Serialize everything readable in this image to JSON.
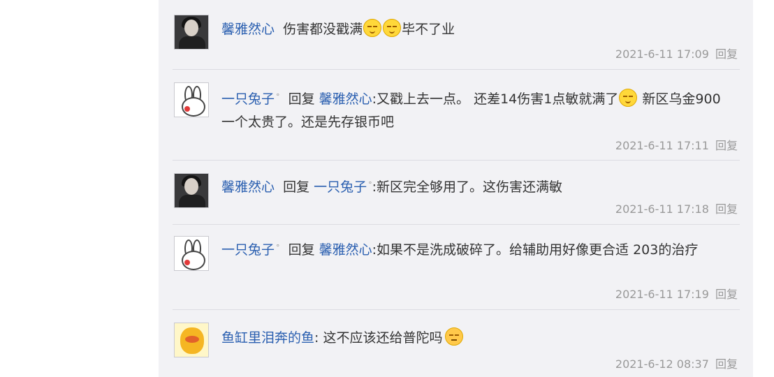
{
  "comments": [
    {
      "author": "馨雅然心",
      "reply_word": "",
      "reply_to": "",
      "text_before": "伤害都没戳满",
      "text_after": "毕不了业",
      "time": "2021-6-11 17:09",
      "reply_label": "回复"
    },
    {
      "author": "一只兔子",
      "author_suffix": "°",
      "reply_word": "回复",
      "reply_to": "馨雅然心",
      "text_before": ":又戳上去一点。 还差14伤害1点敏就满了",
      "text_after": " 新区乌金900一个太贵了。还是先存银币吧",
      "time": "2021-6-11 17:11",
      "reply_label": "回复"
    },
    {
      "author": "馨雅然心",
      "reply_word": "回复",
      "reply_to": "一只兔子",
      "reply_to_suffix": "°",
      "text": ":新区完全够用了。这伤害还满敏",
      "time": "2021-6-11 17:18",
      "reply_label": "回复"
    },
    {
      "author": "一只兔子",
      "author_suffix": "°",
      "reply_word": "回复",
      "reply_to": "馨雅然心",
      "text": ":如果不是洗成破碎了。给辅助用好像更合适 203的治疗",
      "time": "2021-6-11 17:19",
      "reply_label": "回复"
    },
    {
      "author": "鱼缸里泪奔的鱼",
      "text": ": 这不应该还给普陀吗",
      "time": "2021-6-12 08:37",
      "reply_label": "回复"
    }
  ],
  "icons": {
    "smile": "smile-emoji-icon",
    "meh": "meh-emoji-icon"
  },
  "colors": {
    "username": "#2a5fb0",
    "panel_bg": "#f2f2f5",
    "meta": "#999999"
  }
}
